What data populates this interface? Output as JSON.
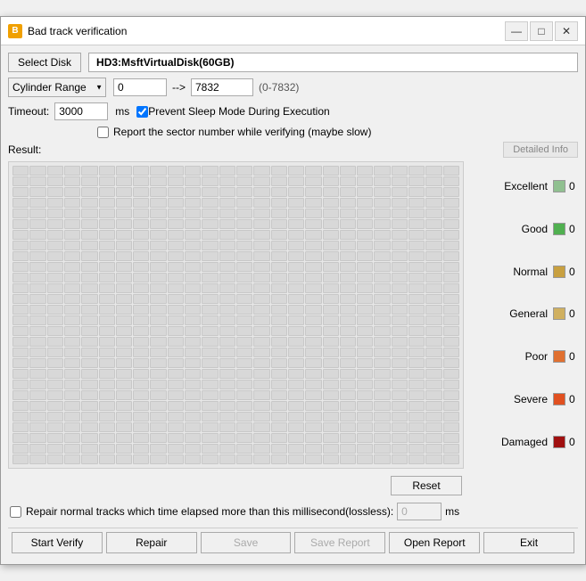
{
  "window": {
    "title": "Bad track verification",
    "icon": "B"
  },
  "titlebar": {
    "minimize_label": "—",
    "maximize_label": "□",
    "close_label": "✕"
  },
  "disk": {
    "select_label": "Select Disk",
    "disk_name": "HD3:MsftVirtualDisk(60GB)"
  },
  "cylinder_range": {
    "label": "Cylinder Range",
    "start_value": "0",
    "end_value": "7832",
    "range_info": "(0-7832)",
    "arrow": "-->"
  },
  "timeout": {
    "label": "Timeout:",
    "value": "3000",
    "unit": "ms"
  },
  "checkboxes": {
    "prevent_sleep": {
      "label": "Prevent Sleep Mode During Execution",
      "checked": true
    },
    "report_sector": {
      "label": "Report the sector number while verifying (maybe slow)",
      "checked": false
    }
  },
  "result": {
    "label": "Result:",
    "detailed_info_btn": "Detailed Info"
  },
  "legend": {
    "items": [
      {
        "label": "Excellent",
        "color": "#90c090",
        "count": "0"
      },
      {
        "label": "Good",
        "color": "#50b050",
        "count": "0"
      },
      {
        "label": "Normal",
        "color": "#c8a040",
        "count": "0"
      },
      {
        "label": "General",
        "color": "#d0b060",
        "count": "0"
      },
      {
        "label": "Poor",
        "color": "#e07030",
        "count": "0"
      },
      {
        "label": "Severe",
        "color": "#e05020",
        "count": "0"
      },
      {
        "label": "Damaged",
        "color": "#a01010",
        "count": "0"
      }
    ]
  },
  "reset_btn": "Reset",
  "repair": {
    "label": "Repair normal tracks which time elapsed more than this millisecond(lossless):",
    "value": "0",
    "unit": "ms",
    "checked": false
  },
  "toolbar": {
    "start_verify": "Start Verify",
    "repair": "Repair",
    "save": "Save",
    "save_report": "Save Report",
    "open_report": "Open Report",
    "exit": "Exit"
  }
}
